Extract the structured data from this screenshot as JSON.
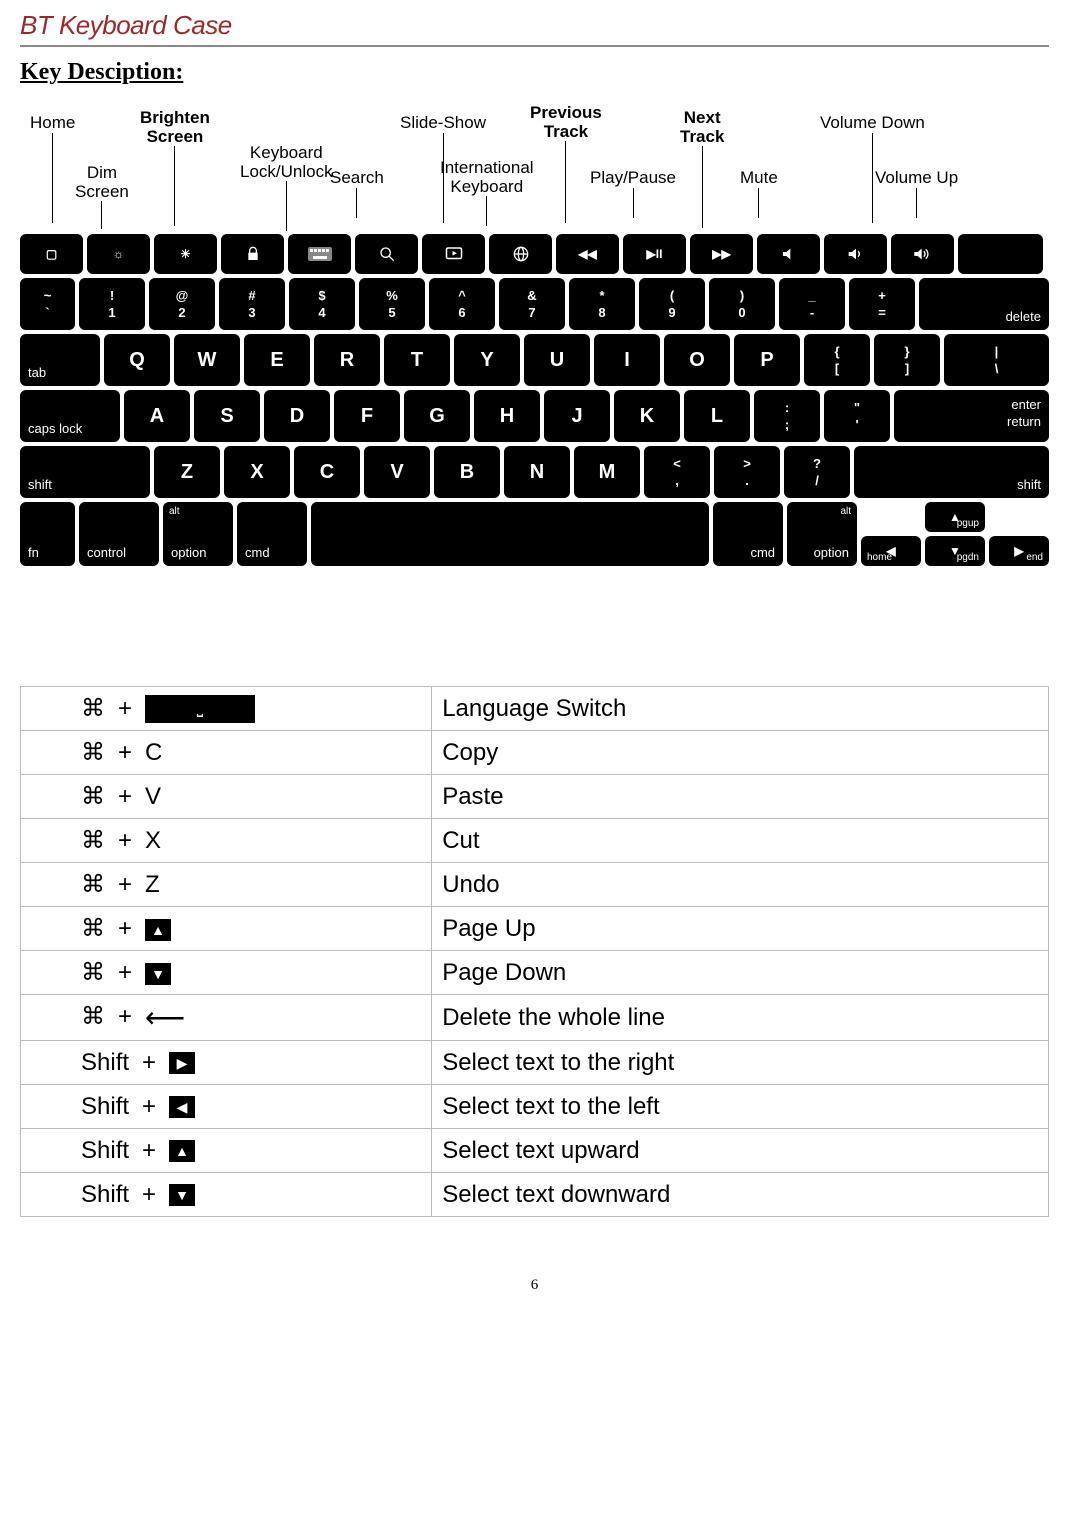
{
  "title": "BT Keyboard Case",
  "section_title": "Key Desciption:",
  "fn_labels": {
    "home": "Home",
    "dim": "Dim\nScreen",
    "brighten": "Brighten\nScreen",
    "lock": "Keyboard\nLock/Unlock",
    "search": "Search",
    "slideshow": "Slide-Show",
    "intl": "International\nKeyboard",
    "prev": "Previous\nTrack",
    "play": "Play/Pause",
    "next": "Next\nTrack",
    "mute": "Mute",
    "voldown": "Volume Down",
    "volup": "Volume Up"
  },
  "row1": {
    "tilde_top": "~",
    "tilde_bot": "`",
    "k1t": "!",
    "k1b": "1",
    "k2t": "@",
    "k2b": "2",
    "k3t": "#",
    "k3b": "3",
    "k4t": "$",
    "k4b": "4",
    "k5t": "%",
    "k5b": "5",
    "k6t": "^",
    "k6b": "6",
    "k7t": "&",
    "k7b": "7",
    "k8t": "*",
    "k8b": "8",
    "k9t": "(",
    "k9b": "9",
    "k0t": ")",
    "k0b": "0",
    "kmint": "_",
    "kminb": "-",
    "keqt": "+",
    "keqb": "=",
    "delete": "delete"
  },
  "row2": {
    "tab": "tab",
    "q": "Q",
    "w": "W",
    "e": "E",
    "r": "R",
    "t": "T",
    "y": "Y",
    "u": "U",
    "i": "I",
    "o": "O",
    "p": "P",
    "lbrkt": "{",
    "lbrkb": "[",
    "rbrkt": "}",
    "rbrkb": "]",
    "bslt": "|",
    "bslb": "\\"
  },
  "row3": {
    "caps": "caps lock",
    "a": "A",
    "s": "S",
    "d": "D",
    "f": "F",
    "g": "G",
    "h": "H",
    "j": "J",
    "k": "K",
    "l": "L",
    "semit": ":",
    "semib": ";",
    "quott": "\"",
    "quotb": "'",
    "enter1": "enter",
    "enter2": "return"
  },
  "row4": {
    "shiftl": "shift",
    "z": "Z",
    "x": "X",
    "c": "C",
    "v": "V",
    "b": "B",
    "n": "N",
    "m": "M",
    "commat": "<",
    "commab": ",",
    "dott": ">",
    "dotb": ".",
    "slasht": "?",
    "slashb": "/",
    "shiftr": "shift"
  },
  "row5": {
    "fn": "fn",
    "ctrl": "control",
    "optl": "option",
    "cmdl": "cmd",
    "cmdr": "cmd",
    "optr": "option",
    "alt": "alt",
    "pgup": "pgup",
    "pgdn": "pgdn",
    "home": "home",
    "end": "end"
  },
  "shortcuts": [
    {
      "mod": "⌘",
      "plus": "+",
      "key_type": "space",
      "desc": "Language Switch"
    },
    {
      "mod": "⌘",
      "plus": "+",
      "key_type": "text",
      "key": "C",
      "desc": "Copy"
    },
    {
      "mod": "⌘",
      "plus": "+",
      "key_type": "text",
      "key": "V",
      "desc": "Paste"
    },
    {
      "mod": "⌘",
      "plus": "+",
      "key_type": "text",
      "key": "X",
      "desc": "Cut"
    },
    {
      "mod": "⌘",
      "plus": "+",
      "key_type": "text",
      "key": "Z",
      "desc": "Undo"
    },
    {
      "mod": "⌘",
      "plus": "+",
      "key_type": "glyph",
      "key": "▲",
      "desc": "Page Up"
    },
    {
      "mod": "⌘",
      "plus": "+",
      "key_type": "glyph",
      "key": "▼",
      "desc": "Page Down"
    },
    {
      "mod": "⌘",
      "plus": "+",
      "key_type": "longarrow",
      "desc": "Delete the whole line"
    },
    {
      "mod": "Shift",
      "plus": "+",
      "key_type": "glyph",
      "key": "▶",
      "desc": "Select text to the right"
    },
    {
      "mod": "Shift",
      "plus": "+",
      "key_type": "glyph",
      "key": "◀",
      "desc": "Select text to the left"
    },
    {
      "mod": "Shift",
      "plus": "+",
      "key_type": "glyph",
      "key": "▲",
      "desc": "Select text upward"
    },
    {
      "mod": "Shift",
      "plus": "+",
      "key_type": "glyph",
      "key": "▼",
      "desc": "Select text downward"
    }
  ],
  "pagenum": "6"
}
